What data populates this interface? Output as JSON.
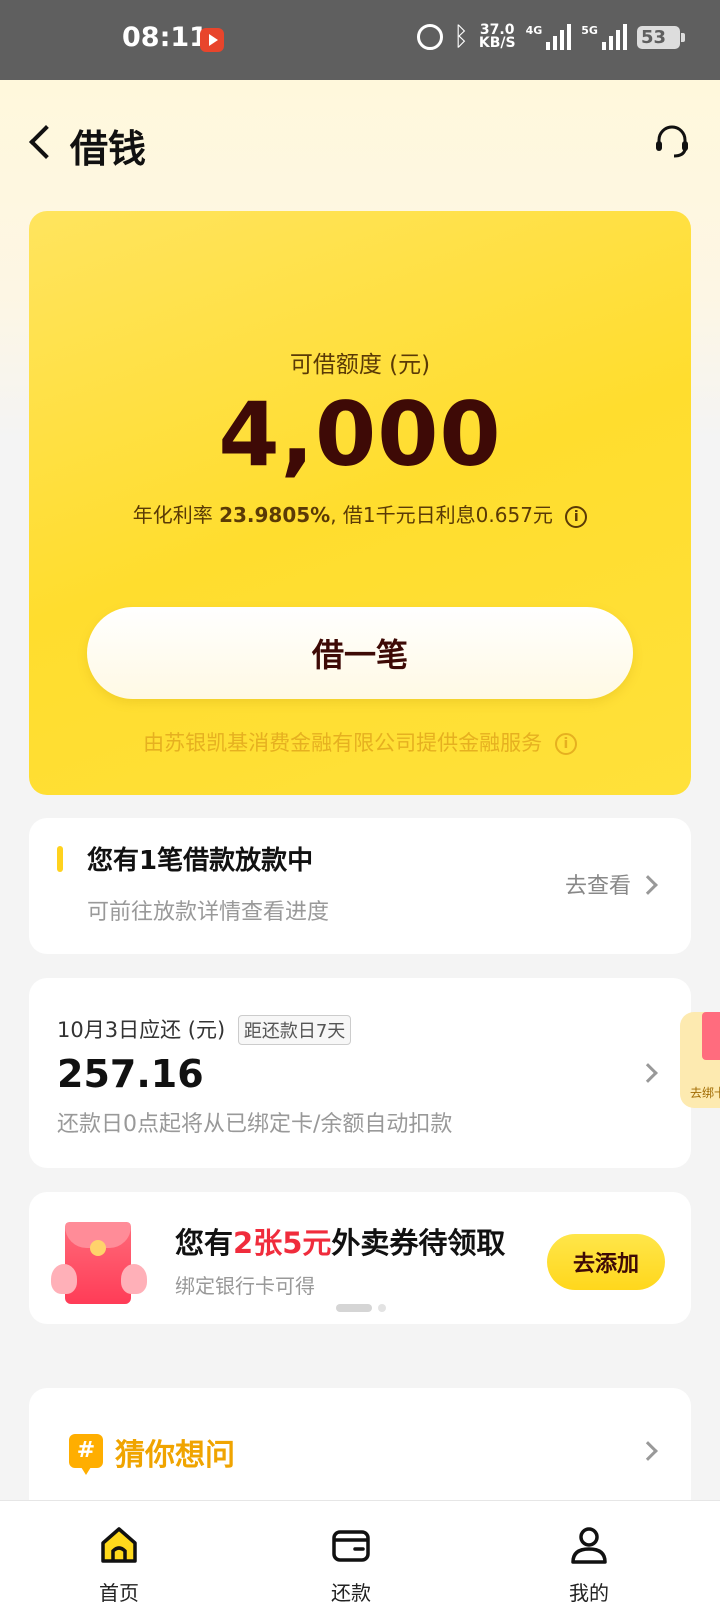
{
  "status_bar": {
    "time": "08:11",
    "speed_value": "37.0",
    "speed_unit": "KB/S",
    "net1": "4G",
    "net2": "5G",
    "battery": "53"
  },
  "header": {
    "title": "借钱",
    "back_icon": "chevron-left-icon",
    "service_icon": "headset-icon"
  },
  "loan_card": {
    "limit_label": "可借额度 (元)",
    "limit_amount": "4,000",
    "rate_prefix": "年化利率",
    "rate_value": "23.9805%",
    "rate_suffix": ", 借1千元日利息0.657元",
    "borrow_button": "借一笔",
    "provider_text": "由苏银凯基消费金融有限公司提供金融服务",
    "colors": {
      "card": "#ffdf3a",
      "amount_text": "#3e0a06",
      "provider_text": "#e6b020"
    }
  },
  "notice": {
    "title": "您有1笔借款放款中",
    "subtitle": "可前往放款详情查看进度",
    "link": "去查看"
  },
  "repayment": {
    "due_label": "10月3日应还 (元)",
    "countdown_tag": "距还款日7天",
    "amount": "257.16",
    "note": "还款日0点起将从已绑定卡/余额自动扣款"
  },
  "promo": {
    "title_prefix": "您有",
    "title_highlight": "2张5元",
    "title_suffix": "外卖券待领取",
    "subtitle": "绑定银行卡可得",
    "button": "去添加",
    "highlight_color": "#f02c3c"
  },
  "float_tab": {
    "label": "去绑卡"
  },
  "faq": {
    "title": "猜你想问",
    "icon_symbol": "#"
  },
  "bottom_nav": {
    "items": [
      {
        "label": "首页",
        "icon": "home-icon",
        "active": true
      },
      {
        "label": "还款",
        "icon": "wallet-icon",
        "active": false
      },
      {
        "label": "我的",
        "icon": "user-icon",
        "active": false
      }
    ]
  }
}
